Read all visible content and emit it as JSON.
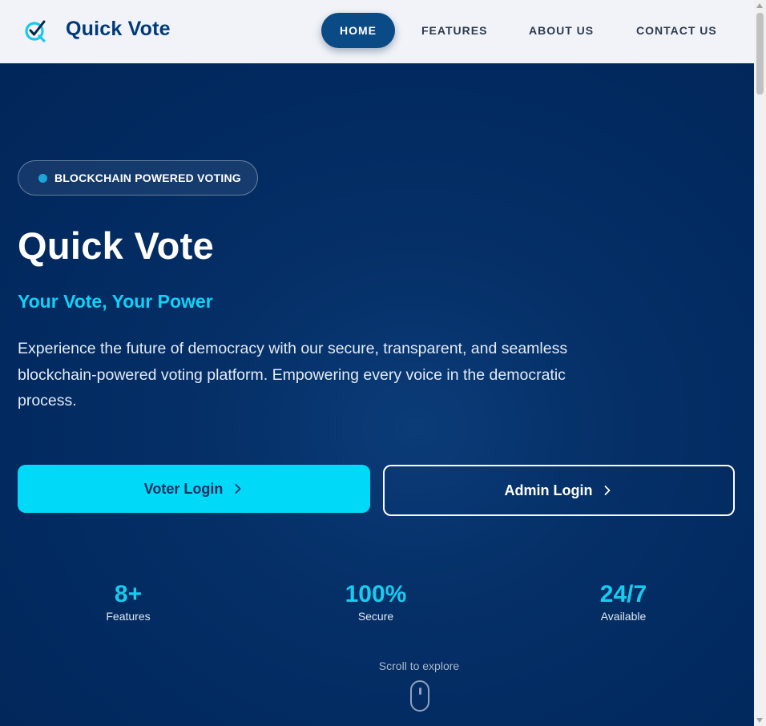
{
  "brand": {
    "name": "Quick Vote",
    "logo_icon": "check-q-icon"
  },
  "nav": {
    "items": [
      {
        "label": "HOME",
        "active": true
      },
      {
        "label": "FEATURES",
        "active": false
      },
      {
        "label": "ABOUT US",
        "active": false
      },
      {
        "label": "CONTACT US",
        "active": false
      }
    ]
  },
  "hero": {
    "badge": "BLOCKCHAIN POWERED VOTING",
    "title": "Quick Vote",
    "tagline": "Your Vote, Your Power",
    "description": "Experience the future of democracy with our secure, transparent, and seamless blockchain-powered voting platform. Empowering every voice in the democratic process.",
    "buttons": {
      "voter_login": "Voter Login",
      "admin_login": "Admin Login"
    },
    "stats": [
      {
        "value": "8+",
        "label": "Features"
      },
      {
        "value": "100%",
        "label": "Secure"
      },
      {
        "value": "24/7",
        "label": "Available"
      }
    ],
    "scroll_hint": "Scroll to explore"
  },
  "colors": {
    "header_bg": "#f1f3f8",
    "brand_text": "#003a7a",
    "nav_active_bg": "#0a4a85",
    "hero_bg": "#022a60",
    "accent_cyan": "#00d9f7",
    "tagline": "#0fd2f6"
  }
}
